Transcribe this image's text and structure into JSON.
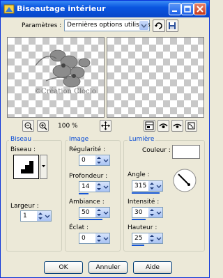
{
  "window": {
    "title": "Biseautage intérieur"
  },
  "params": {
    "label": "Paramètres :",
    "value": "Dernières options utilisées"
  },
  "preview": {
    "watermark": "©Création Cloclo"
  },
  "zoom": {
    "value": "100 %"
  },
  "biseau": {
    "title": "Biseau",
    "bevel_label": "Biseau :",
    "width_label": "Largeur :",
    "width_value": "1"
  },
  "image": {
    "title": "Image",
    "smooth_label": "Régularité :",
    "smooth_value": "0",
    "depth_label": "Profondeur :",
    "depth_value": "14",
    "ambient_label": "Ambiance :",
    "ambient_value": "50",
    "shine_label": "Éclat :",
    "shine_value": "0"
  },
  "lumiere": {
    "title": "Lumière",
    "color_label": "Couleur :",
    "angle_label": "Angle :",
    "angle_value": "315",
    "intensity_label": "Intensité :",
    "intensity_value": "30",
    "height_label": "Hauteur :",
    "height_value": "25"
  },
  "buttons": {
    "ok": "OK",
    "cancel": "Annuler",
    "help": "Aide"
  },
  "colors": {
    "title_bar": "#0a55e0",
    "group_title": "#0046d5",
    "slider_fill": "#1455d5"
  }
}
